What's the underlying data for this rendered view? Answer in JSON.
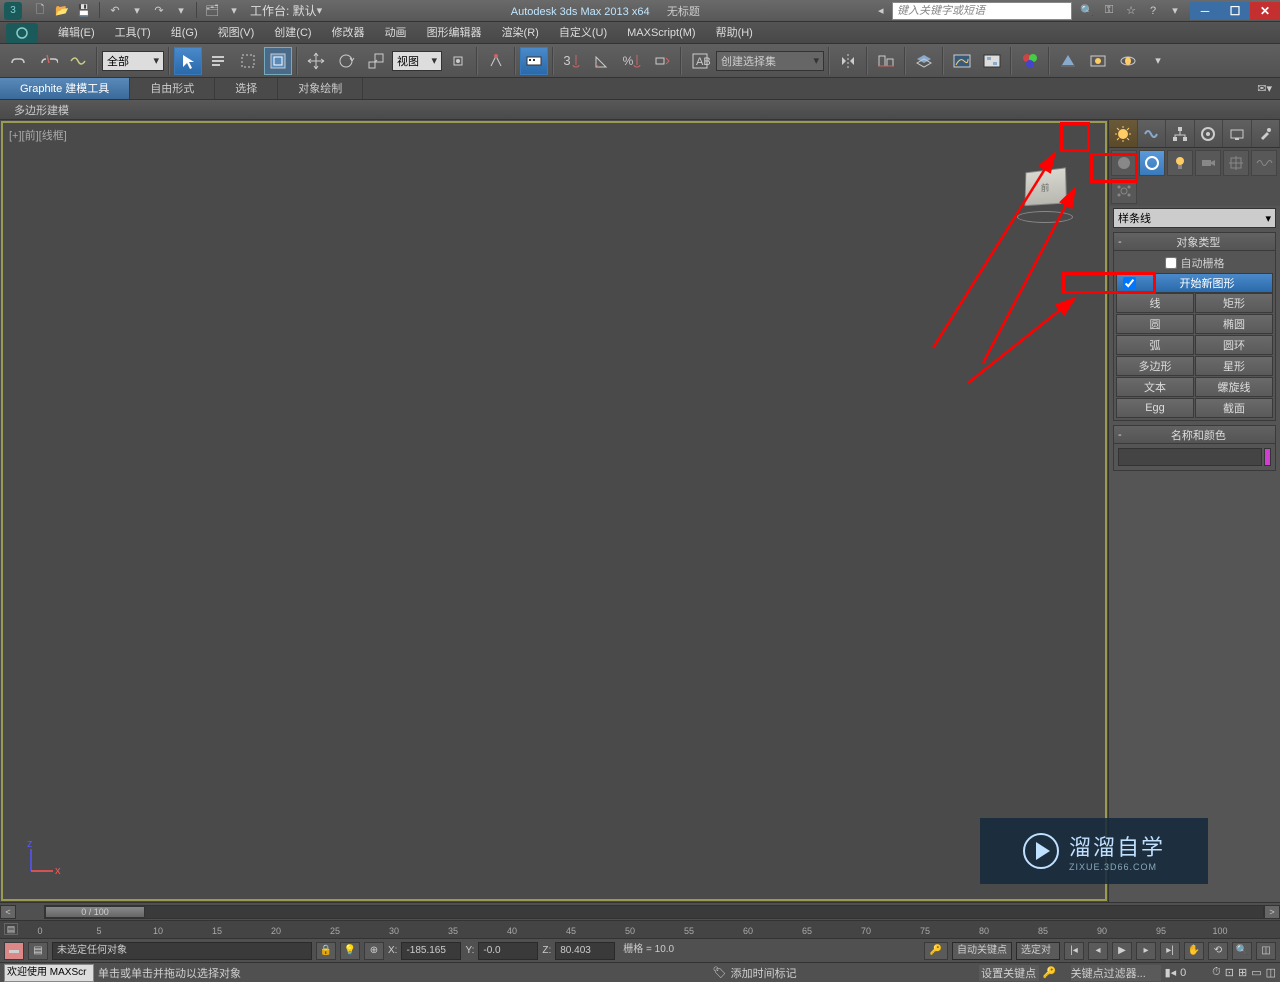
{
  "titlebar": {
    "workspace_label": "工作台: 默认",
    "app_title": "Autodesk 3ds Max  2013 x64",
    "doc_title": "无标题",
    "search_placeholder": "键入关键字或短语"
  },
  "menu": {
    "items": [
      "编辑(E)",
      "工具(T)",
      "组(G)",
      "视图(V)",
      "创建(C)",
      "修改器",
      "动画",
      "图形编辑器",
      "渲染(R)",
      "自定义(U)",
      "MAXScript(M)",
      "帮助(H)"
    ]
  },
  "toolbar": {
    "filter_all": "全部",
    "view_dropdown": "视图",
    "named_sel": "创建选择集"
  },
  "ribbon": {
    "tabs": [
      "Graphite 建模工具",
      "自由形式",
      "选择",
      "对象绘制"
    ],
    "subtab": "多边形建模"
  },
  "viewport": {
    "label": "[+][前][线框]"
  },
  "cmdpanel": {
    "dropdown": "样条线",
    "rollout_objtype": "对象类型",
    "autogrid": "自动栅格",
    "start_new_shape": "开始新图形",
    "buttons": [
      [
        "线",
        "矩形"
      ],
      [
        "圆",
        "椭圆"
      ],
      [
        "弧",
        "圆环"
      ],
      [
        "多边形",
        "星形"
      ],
      [
        "文本",
        "螺旋线"
      ],
      [
        "Egg",
        "截面"
      ]
    ],
    "rollout_namecolor": "名称和颜色"
  },
  "timeline": {
    "current": "0 / 100",
    "ticks": [
      "0",
      "5",
      "10",
      "15",
      "20",
      "25",
      "30",
      "35",
      "40",
      "45",
      "50",
      "55",
      "60",
      "65",
      "70",
      "75",
      "80",
      "85",
      "90",
      "95",
      "100"
    ]
  },
  "status": {
    "no_selection": "未选定任何对象",
    "hint": "单击或单击并拖动以选择对象",
    "welcome": "欢迎使用  MAXScr",
    "x_label": "X:",
    "x_val": "-185.165",
    "y_label": "Y:",
    "y_val": "-0.0",
    "z_label": "Z:",
    "z_val": "80.403",
    "grid": "栅格 = 10.0",
    "add_time_tag": "添加时间标记",
    "autokey": "自动关键点",
    "setkey": "设置关键点",
    "selected": "选定对",
    "keyfilter": "关键点过滤器..."
  },
  "watermark": {
    "main": "溜溜自学",
    "sub": "ZIXUE.3D66.COM"
  }
}
